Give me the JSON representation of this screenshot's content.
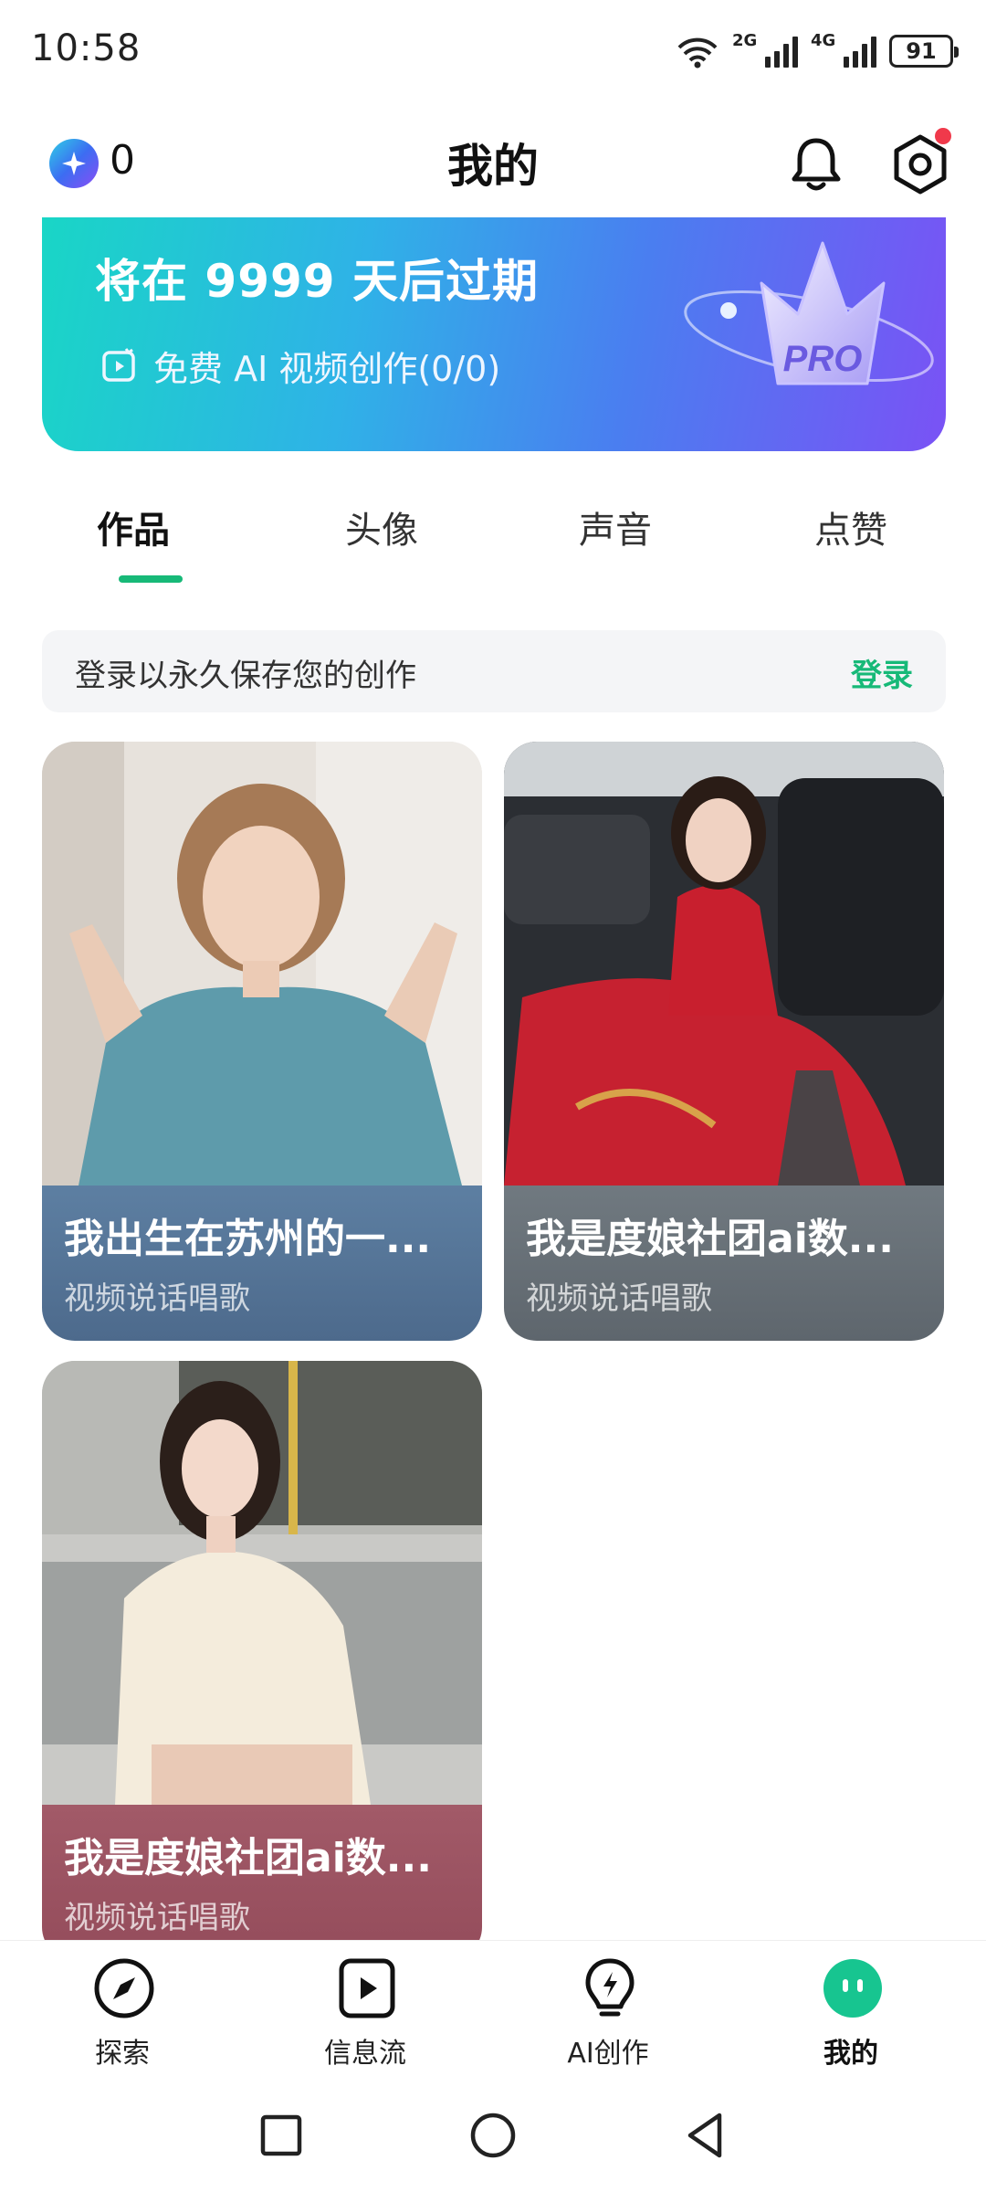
{
  "status_bar": {
    "time": "10:58",
    "sim1": "2G",
    "sim2": "4G",
    "battery": "91"
  },
  "header": {
    "coin_count": "0",
    "title": "我的",
    "icons": [
      "spark-coin-icon",
      "bell-icon",
      "settings-icon"
    ]
  },
  "banner": {
    "title": "将在 9999 天后过期",
    "subtitle": "免费 AI 视频创作(0/0)",
    "badge": "PRO"
  },
  "tabs": [
    {
      "label": "作品",
      "active": true
    },
    {
      "label": "头像",
      "active": false
    },
    {
      "label": "声音",
      "active": false
    },
    {
      "label": "点赞",
      "active": false
    }
  ],
  "login_prompt": {
    "text": "登录以永久保存您的创作",
    "action": "登录"
  },
  "works": [
    {
      "title": "我出生在苏州的一...",
      "subtitle": "视频说话唱歌",
      "caption_color": "#5a7a9e"
    },
    {
      "title": "我是度娘社团ai数...",
      "subtitle": "视频说话唱歌",
      "caption_color": "#6a737c"
    },
    {
      "title": "我是度娘社团ai数...",
      "subtitle": "视频说话唱歌",
      "caption_color": "#9a5562"
    }
  ],
  "bottom_nav": [
    {
      "label": "探索",
      "icon": "compass-icon",
      "active": false
    },
    {
      "label": "信息流",
      "icon": "play-icon",
      "active": false
    },
    {
      "label": "AI创作",
      "icon": "bulb-icon",
      "active": false
    },
    {
      "label": "我的",
      "icon": "profile-face-icon",
      "active": true
    }
  ],
  "colors": {
    "accent": "#17b978",
    "banner_start": "#19d6c6",
    "banner_end": "#7a52f5",
    "notification_dot": "#f0394b"
  }
}
